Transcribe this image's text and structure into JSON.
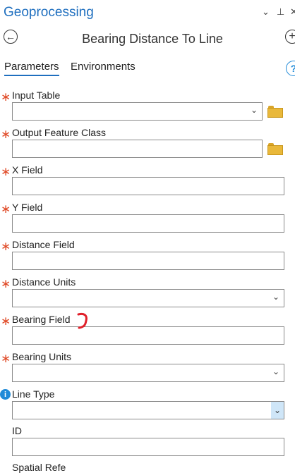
{
  "pane": {
    "title": "Geoprocessing",
    "chevron": "⌄",
    "pin": "⊥",
    "close": "✕"
  },
  "tool": {
    "title": "Bearing Distance To Line",
    "back_icon": "back-arrow-icon",
    "add_icon": "plus-icon"
  },
  "tabs": [
    {
      "label": "Parameters",
      "active": true
    },
    {
      "label": "Environments",
      "active": false
    }
  ],
  "help": {
    "label": "?"
  },
  "params": [
    {
      "label": "Input Table",
      "required": true,
      "control": "dropdown-browse",
      "value": ""
    },
    {
      "label": "Output Feature Class",
      "required": true,
      "control": "text-browse",
      "value": ""
    },
    {
      "label": "X Field",
      "required": true,
      "control": "text",
      "value": ""
    },
    {
      "label": "Y Field",
      "required": true,
      "control": "text",
      "value": ""
    },
    {
      "label": "Distance Field",
      "required": true,
      "control": "text",
      "value": ""
    },
    {
      "label": "Distance Units",
      "required": true,
      "control": "dropdown",
      "value": ""
    },
    {
      "label": "Bearing Field",
      "required": true,
      "control": "text",
      "value": ""
    },
    {
      "label": "Bearing Units",
      "required": true,
      "control": "dropdown",
      "value": ""
    },
    {
      "label": "Line Type",
      "required": false,
      "info": true,
      "control": "dropdown-active",
      "value": ""
    },
    {
      "label": "ID",
      "required": false,
      "control": "text",
      "value": ""
    }
  ],
  "partial": {
    "label": "Spatial Refe"
  },
  "colors": {
    "accent": "#1f6fbf",
    "required": "#e04b28",
    "annotation": "#e0202a",
    "folder": "#e9b83a"
  },
  "symbols": {
    "required_mark": "∗",
    "dropdown": "⌄",
    "info": "i"
  }
}
